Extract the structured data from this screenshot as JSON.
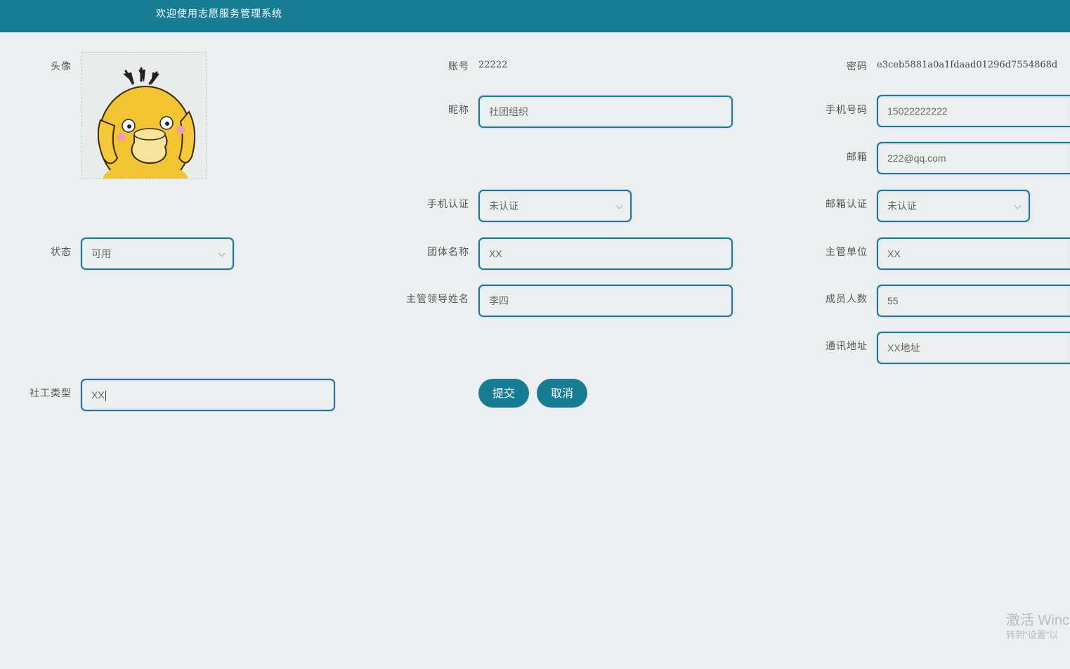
{
  "header": {
    "title": "欢迎使用志愿服务管理系统"
  },
  "form": {
    "avatar": {
      "label": "头像"
    },
    "account": {
      "label": "账号",
      "value": "22222"
    },
    "password": {
      "label": "密码",
      "value": "e3ceb5881a0a1fdaad01296d7554868d"
    },
    "nickname": {
      "label": "昵称",
      "value": "社团组织"
    },
    "phone": {
      "label": "手机号码",
      "value": "15022222222"
    },
    "email": {
      "label": "邮箱",
      "value": "222@qq.com"
    },
    "phone_verify": {
      "label": "手机认证",
      "value": "未认证"
    },
    "email_verify": {
      "label": "邮箱认证",
      "value": "未认证"
    },
    "status": {
      "label": "状态",
      "value": "可用"
    },
    "group_name": {
      "label": "团体名称",
      "value": "XX"
    },
    "supervisor_unit": {
      "label": "主管单位",
      "value": "XX"
    },
    "leader_name": {
      "label": "主管领导姓名",
      "value": "李四"
    },
    "member_count": {
      "label": "成员人数",
      "value": "55"
    },
    "address": {
      "label": "通讯地址",
      "value": "XX地址"
    },
    "social_type": {
      "label": "社工类型",
      "value": "XX"
    }
  },
  "buttons": {
    "submit": "提交",
    "cancel": "取消"
  },
  "watermark": {
    "line1": "激活 Winc",
    "line2": "转到\"设置\"以"
  },
  "colors": {
    "primary": "#177d94",
    "background": "#eceff0",
    "duck_yellow": "#f2c431"
  },
  "icons": {
    "chevron": "chevron-down-icon"
  }
}
